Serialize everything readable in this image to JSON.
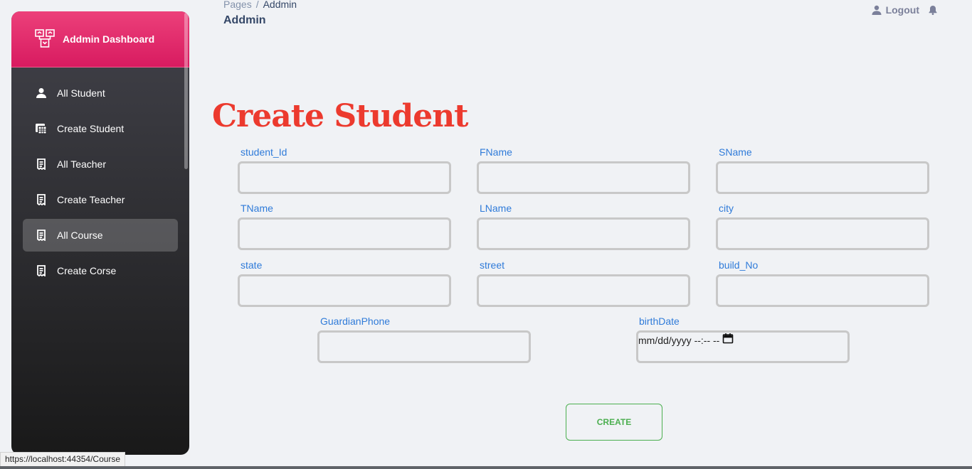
{
  "sidebar": {
    "brand": "Addmin Dashboard",
    "items": [
      {
        "label": "All Student"
      },
      {
        "label": "Create Student"
      },
      {
        "label": "All Teacher"
      },
      {
        "label": "Create Teacher"
      },
      {
        "label": "All Course"
      },
      {
        "label": "Create Corse"
      }
    ]
  },
  "header": {
    "breadcrumb_root": "Pages",
    "breadcrumb_sep": "/",
    "breadcrumb_current": "Addmin",
    "subtitle": "Addmin",
    "logout_label": "Logout"
  },
  "form": {
    "title": "Create Student",
    "fields": [
      {
        "label": "student_Id",
        "value": ""
      },
      {
        "label": "FName",
        "value": ""
      },
      {
        "label": "SName",
        "value": ""
      },
      {
        "label": "TName",
        "value": ""
      },
      {
        "label": "LName",
        "value": ""
      },
      {
        "label": "city",
        "value": ""
      },
      {
        "label": "state",
        "value": ""
      },
      {
        "label": "street",
        "value": ""
      },
      {
        "label": "build_No",
        "value": ""
      },
      {
        "label": "GuardianPhone",
        "value": ""
      },
      {
        "label": "birthDate",
        "value": "mm/dd/yyyy --:-- --"
      }
    ],
    "submit_label": "CREATE"
  },
  "statusbar": {
    "url": "https://localhost:44354/Course"
  },
  "colors": {
    "accent": "#e91e63",
    "title": "#ec3a2e",
    "label": "#2f7bd9",
    "submit": "#4caf50"
  }
}
